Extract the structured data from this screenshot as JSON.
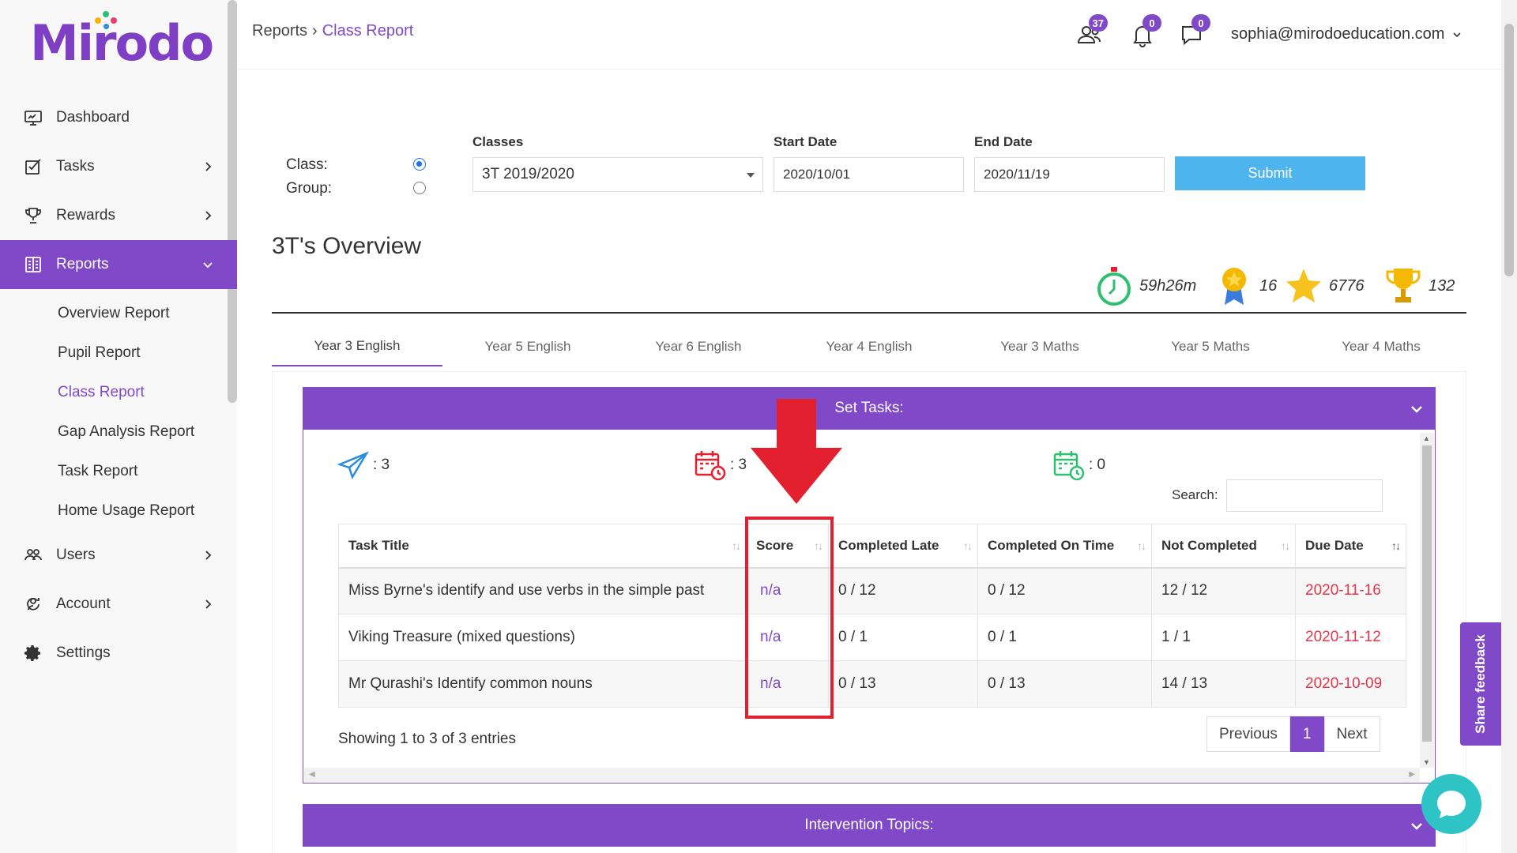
{
  "logo": "Mirodo",
  "sidebar": {
    "items": [
      {
        "label": "Dashboard"
      },
      {
        "label": "Tasks"
      },
      {
        "label": "Rewards"
      },
      {
        "label": "Reports"
      },
      {
        "label": "Users"
      },
      {
        "label": "Account"
      },
      {
        "label": "Settings"
      }
    ],
    "report_links": [
      "Overview Report",
      "Pupil Report",
      "Class Report",
      "Gap Analysis Report",
      "Task Report",
      "Home Usage Report"
    ]
  },
  "header": {
    "breadcrumb": {
      "parent": "Reports",
      "current": "Class Report"
    },
    "users_badge": "37",
    "notifications_badge": "0",
    "messages_badge": "0",
    "user_email": "sophia@mirodoeducation.com"
  },
  "filters": {
    "class_label": "Class:",
    "group_label": "Group:",
    "classes_label": "Classes",
    "class_value": "3T 2019/2020",
    "start_label": "Start Date",
    "start_value": "2020/10/01",
    "end_label": "End Date",
    "end_value": "2020/11/19",
    "submit": "Submit"
  },
  "overview": {
    "title": "3T's Overview",
    "time": "59h26m",
    "medals": "16",
    "stars": "6776",
    "trophies": "132"
  },
  "tabs": [
    "Year 3 English",
    "Year 5 English",
    "Year 6 English",
    "Year 4 English",
    "Year 3 Maths",
    "Year 5 Maths",
    "Year 4 Maths"
  ],
  "set_tasks": {
    "title": "Set Tasks:",
    "sent_count": ": 3",
    "due_count": ": 3",
    "done_count": ": 0",
    "search_label": "Search:",
    "columns": [
      "Task Title",
      "Score",
      "Completed Late",
      "Completed On Time",
      "Not Completed",
      "Due Date"
    ],
    "rows": [
      {
        "title": "Miss Byrne's identify and use verbs in the simple past",
        "score": "n/a",
        "late": "0 / 12",
        "on_time": "0 / 12",
        "not_completed": "12 / 12",
        "due": "2020-11-16"
      },
      {
        "title": "Viking Treasure (mixed questions)",
        "score": "n/a",
        "late": "0 / 1",
        "on_time": "0 / 1",
        "not_completed": "1 / 1",
        "due": "2020-11-12"
      },
      {
        "title": "Mr Qurashi's Identify common nouns",
        "score": "n/a",
        "late": "0 / 13",
        "on_time": "0 / 13",
        "not_completed": "14 / 13",
        "due": "2020-10-09"
      }
    ],
    "showing": "Showing 1 to 3 of 3 entries",
    "pager": {
      "prev": "Previous",
      "page": "1",
      "next": "Next"
    }
  },
  "intervention": {
    "title": "Intervention Topics:"
  },
  "feedback": "Share feedback",
  "colors": {
    "brand": "#7f49c8",
    "submit": "#4db4ee",
    "due": "#e3354b",
    "annotation": "#e3202f",
    "chat": "#2ec4c5"
  },
  "icons": [
    "monitor-icon",
    "tasks-icon",
    "trophy-icon",
    "reports-icon",
    "users-icon",
    "account-icon",
    "gear-icon",
    "chevron-right-icon",
    "chevron-down-icon",
    "users-group-icon",
    "bell-icon",
    "chat-icon",
    "stopwatch-icon",
    "medal-icon",
    "star-icon",
    "trophy-icon",
    "paper-plane-icon",
    "calendar-clock-icon",
    "calendar-check-icon",
    "sort-icon"
  ]
}
